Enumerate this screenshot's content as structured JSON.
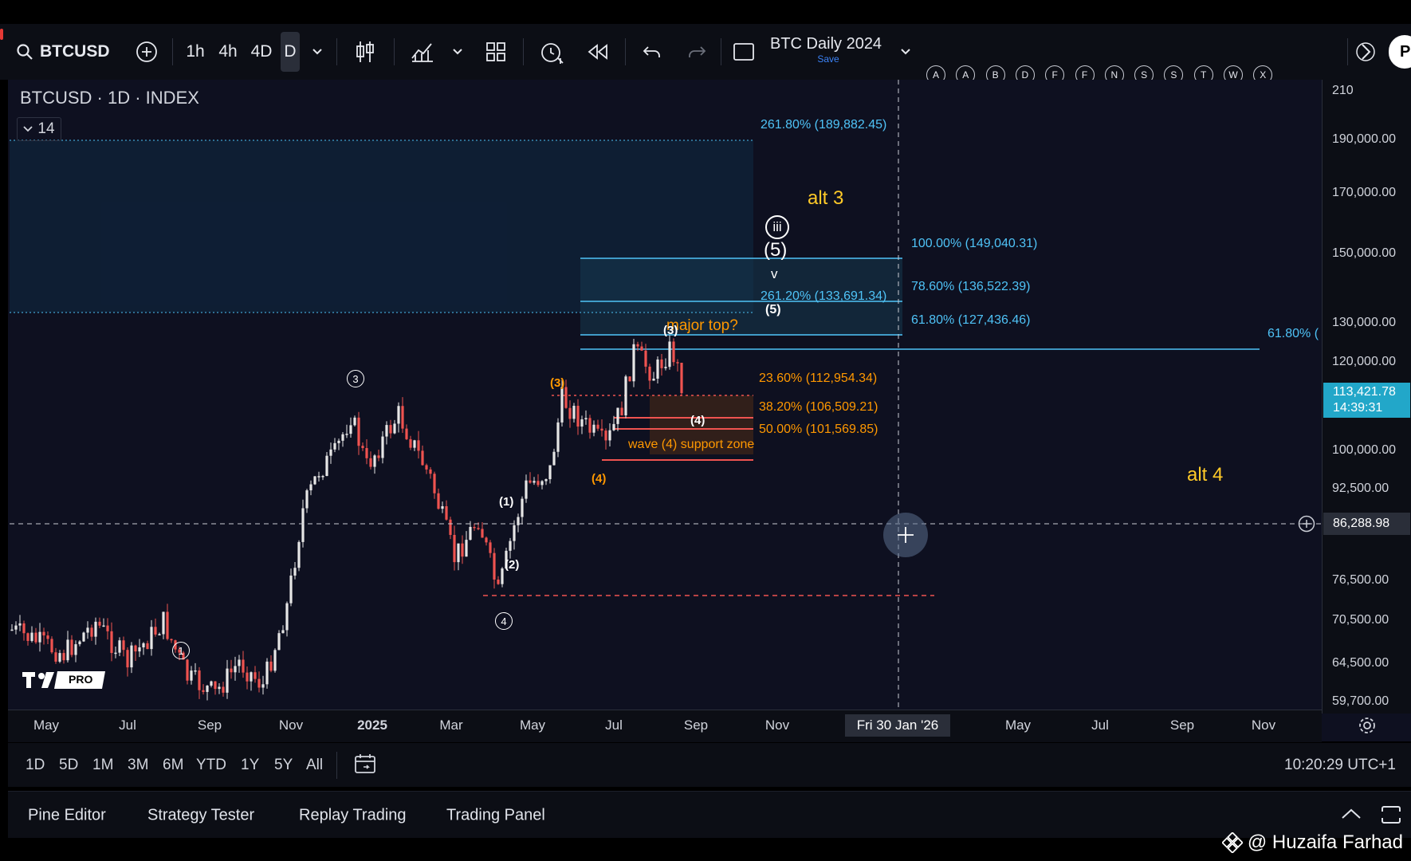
{
  "toolbar": {
    "symbol": "BTCUSD",
    "intervals": [
      "1h",
      "4h",
      "4D",
      "D"
    ],
    "layout_name": "BTC Daily 2024",
    "layout_sub": "Save",
    "circle_tools": [
      "A",
      "A",
      "B",
      "D",
      "F",
      "F",
      "N",
      "S",
      "S",
      "T",
      "W",
      "X"
    ],
    "right_partial": "Pu"
  },
  "chart": {
    "legend": "BTCUSD · 1D · INDEX",
    "collapse_count": "14",
    "logo_badge": "PRO",
    "price_labels": [
      "210",
      "190,000.00",
      "170,000.00",
      "150,000.00",
      "130,000.00",
      "120,000.00",
      "100,000.00",
      "92,500.00",
      "76,500.00",
      "70,500.00",
      "64,500.00",
      "59,700.00"
    ],
    "last_price": "113,421.78",
    "countdown": "14:39:31",
    "crosshair_price": "86,288.98",
    "time_labels": [
      "May",
      "Jul",
      "Sep",
      "Nov",
      "2025",
      "Mar",
      "May",
      "Jul",
      "Sep",
      "Nov",
      "May",
      "Jul",
      "Sep",
      "Nov"
    ],
    "crosshair_date": "Fri 30 Jan '26",
    "fib_labels": {
      "f2618": "261.80% (189,882.45)",
      "f100": "100.00% (149,040.31)",
      "f786": "78.60% (136,522.39)",
      "f2x": "261.20% (133,691.34)",
      "f618": "61.80% (127,436.46)",
      "f618r": "61.80% (",
      "f236": "23.60% (112,954.34)",
      "f382": "38.20% (106,509.21)",
      "f50": "50.00% (101,569.85)"
    },
    "annotations": {
      "alt3": "alt 3",
      "alt4": "alt 4",
      "major_top": "major top?",
      "support_zone": "wave (4) support zone",
      "w_iii": "iii",
      "w_5_big": "(5)",
      "w_v": "v",
      "w_5_small": "(5)",
      "w_3_top": "(3)",
      "w_3_orange": "(3)",
      "w_4_orange": "(4)",
      "w_4_orange2": "(4)",
      "w_1": "(1)",
      "w_2": "(2)",
      "c1": "1",
      "c3": "3",
      "c4": "4"
    },
    "colors": {
      "fib_blue": "#4fc3f7",
      "fib_orange": "#ff9800",
      "alt_yellow": "#ffca28",
      "candle_up": "#e6e6e6",
      "candle_down": "#ef5350",
      "last_price_bg": "#22a7c9"
    }
  },
  "range_buttons": [
    "1D",
    "5D",
    "1M",
    "3M",
    "6M",
    "YTD",
    "1Y",
    "5Y",
    "All"
  ],
  "clock": "10:20:29 UTC+1",
  "panels": [
    "Pine Editor",
    "Strategy Tester",
    "Replay Trading",
    "Trading Panel"
  ],
  "watermark": "@ Huzaifa Farhad"
}
